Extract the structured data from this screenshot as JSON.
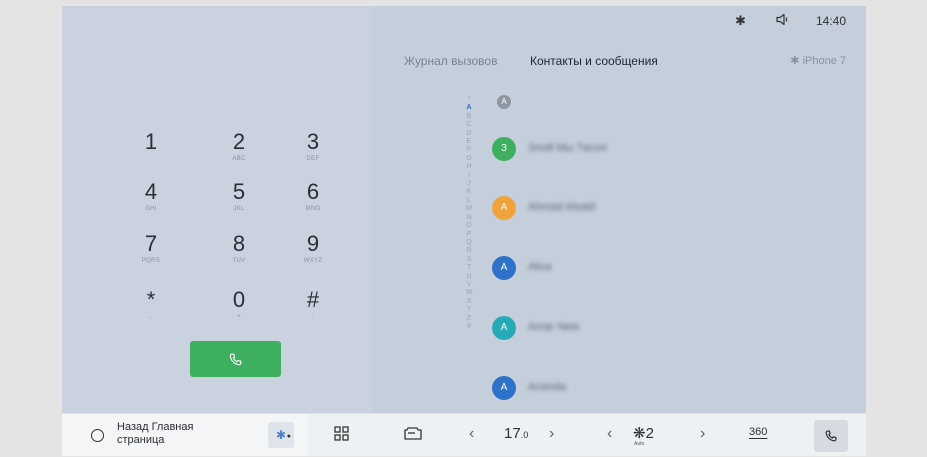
{
  "status": {
    "bluetooth_icon": "bluetooth-icon",
    "volume_icon": "volume-icon",
    "time": "14:40"
  },
  "tabs": [
    {
      "label": "Журнал вызовов",
      "active": false
    },
    {
      "label": "Контакты и сообщения",
      "active": true
    }
  ],
  "device": "✱ iPhone 7",
  "keypad": [
    {
      "digit": "1",
      "letters": ""
    },
    {
      "digit": "2",
      "letters": "ABC"
    },
    {
      "digit": "3",
      "letters": "DEF"
    },
    {
      "digit": "4",
      "letters": "GHI"
    },
    {
      "digit": "5",
      "letters": "JKL"
    },
    {
      "digit": "6",
      "letters": "MNO"
    },
    {
      "digit": "7",
      "letters": "PQRS"
    },
    {
      "digit": "8",
      "letters": "TUV"
    },
    {
      "digit": "9",
      "letters": "WXYZ"
    },
    {
      "digit": "*",
      "letters": ","
    },
    {
      "digit": "0",
      "letters": "+"
    },
    {
      "digit": "#",
      "letters": ";"
    }
  ],
  "call_button": {
    "icon": "phone-icon",
    "color": "#3eae5f"
  },
  "alphabet": [
    "*",
    "A",
    "B",
    "C",
    "D",
    "E",
    "F",
    "G",
    "H",
    "I",
    "J",
    "K",
    "L",
    "M",
    "N",
    "O",
    "P",
    "Q",
    "R",
    "S",
    "T",
    "U",
    "V",
    "W",
    "X",
    "Y",
    "Z",
    "#"
  ],
  "alphabet_active": "A",
  "section_letter": "A",
  "contacts": [
    {
      "initial": "З",
      "name": "Злой Мы Тасол",
      "color": "#3eae5f"
    },
    {
      "initial": "A",
      "name": "Ahmad Alsaid",
      "color": "#f0a33b"
    },
    {
      "initial": "A",
      "name": "Alice",
      "color": "#2e72c9"
    },
    {
      "initial": "A",
      "name": "Amar New",
      "color": "#27aab5"
    },
    {
      "initial": "A",
      "name": "Ananda",
      "color": "#2e72c9"
    }
  ],
  "bottom_bar": {
    "home_label": "Назад Главная страница",
    "bt_icon": "bluetooth-off-icon",
    "apps_icon": "grid-icon",
    "car_icon": "car-icon",
    "temperature": "17",
    "temperature_decimal": ".0",
    "fan_level": "2",
    "fan_auto": "Auto",
    "view360": "360",
    "phone_icon": "phone-icon"
  }
}
